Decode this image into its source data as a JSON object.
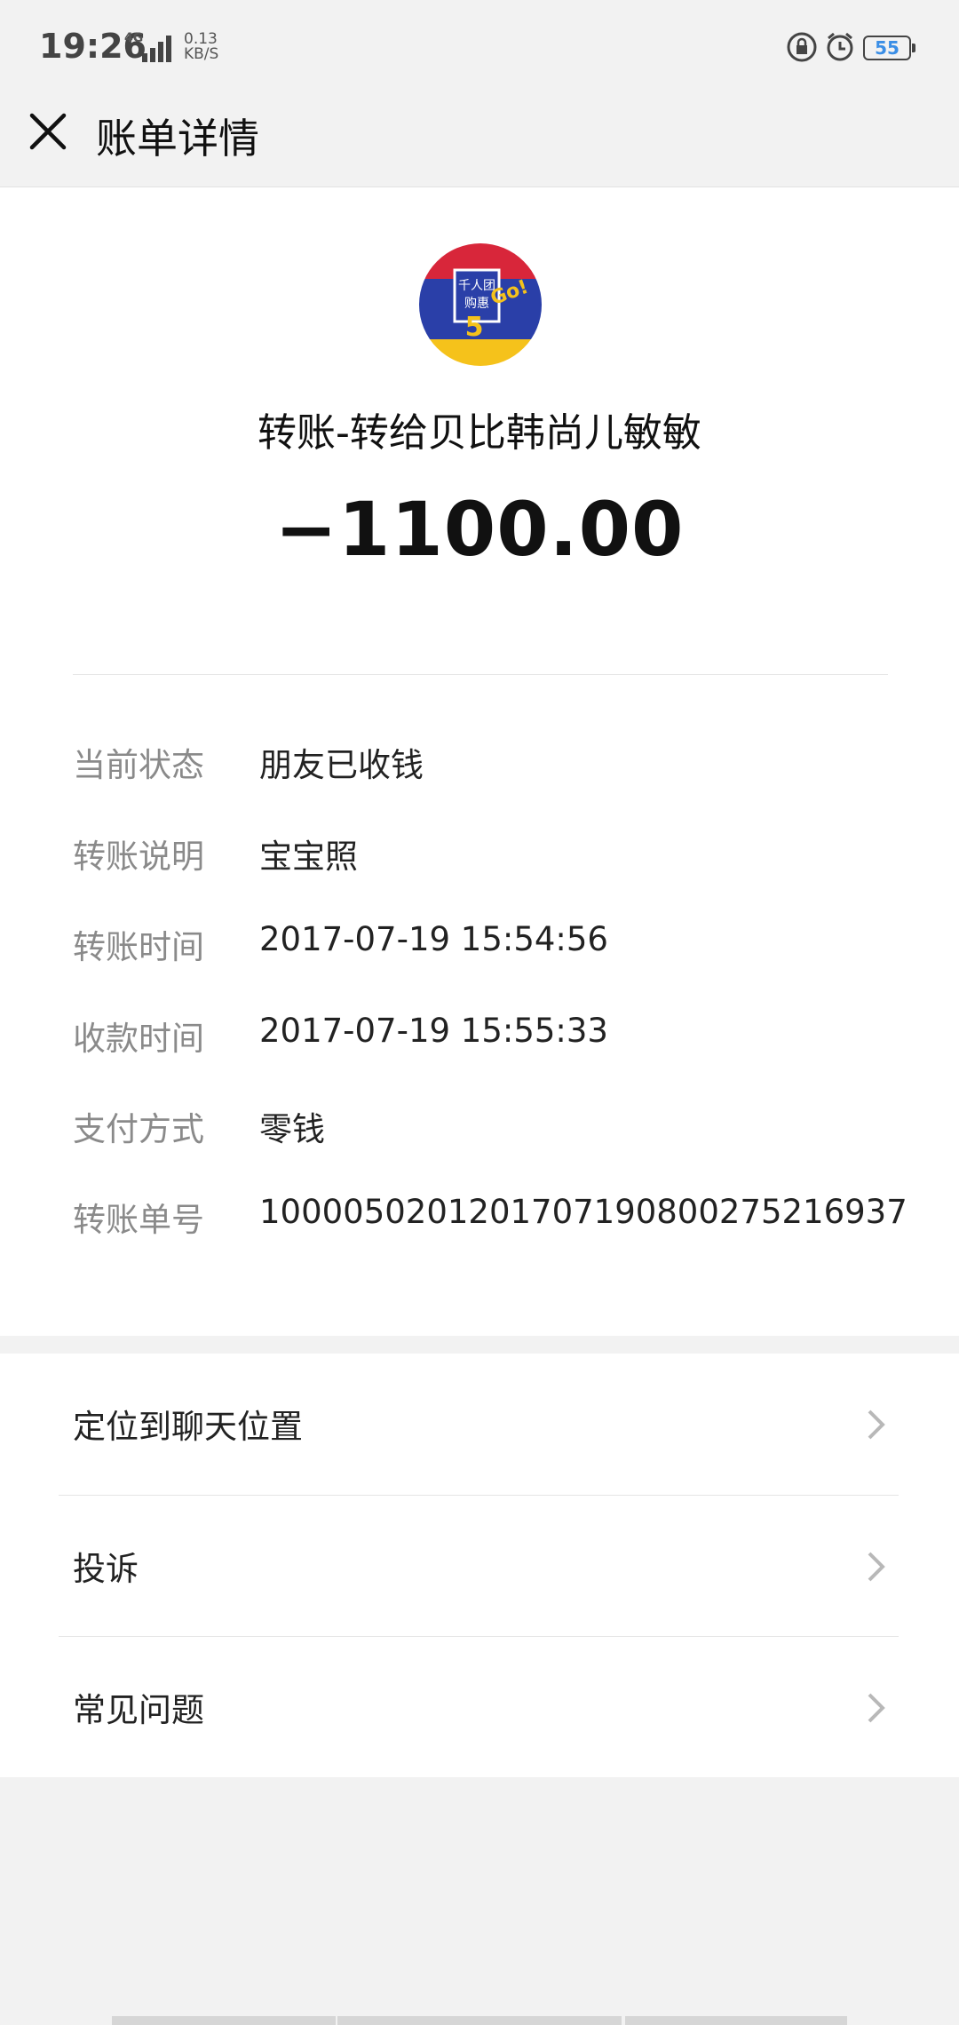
{
  "status_bar": {
    "time": "19:26",
    "network": "4G",
    "speed_value": "0.13",
    "speed_unit": "KB/S",
    "battery": "55"
  },
  "header": {
    "title": "账单详情",
    "close_icon": "close-icon"
  },
  "transaction": {
    "payee": "转账-转给贝比韩尚儿敏敏",
    "amount": "−1100.00",
    "avatar_text": "千人团购惠5 Go!"
  },
  "details": [
    {
      "label": "当前状态",
      "value": "朋友已收钱"
    },
    {
      "label": "转账说明",
      "value": "宝宝照"
    },
    {
      "label": "转账时间",
      "value": "2017-07-19 15:54:56"
    },
    {
      "label": "收款时间",
      "value": "2017-07-19 15:55:33"
    },
    {
      "label": "支付方式",
      "value": "零钱"
    },
    {
      "label": "转账单号",
      "value": "1000050201201707190800275216937"
    }
  ],
  "actions": [
    {
      "label": "定位到聊天位置"
    },
    {
      "label": "投诉"
    },
    {
      "label": "常见问题"
    }
  ],
  "colors": {
    "background": "#f2f2f2",
    "card": "#ffffff",
    "label_gray": "#8a8a8a",
    "battery_blue": "#3a8ee6"
  }
}
